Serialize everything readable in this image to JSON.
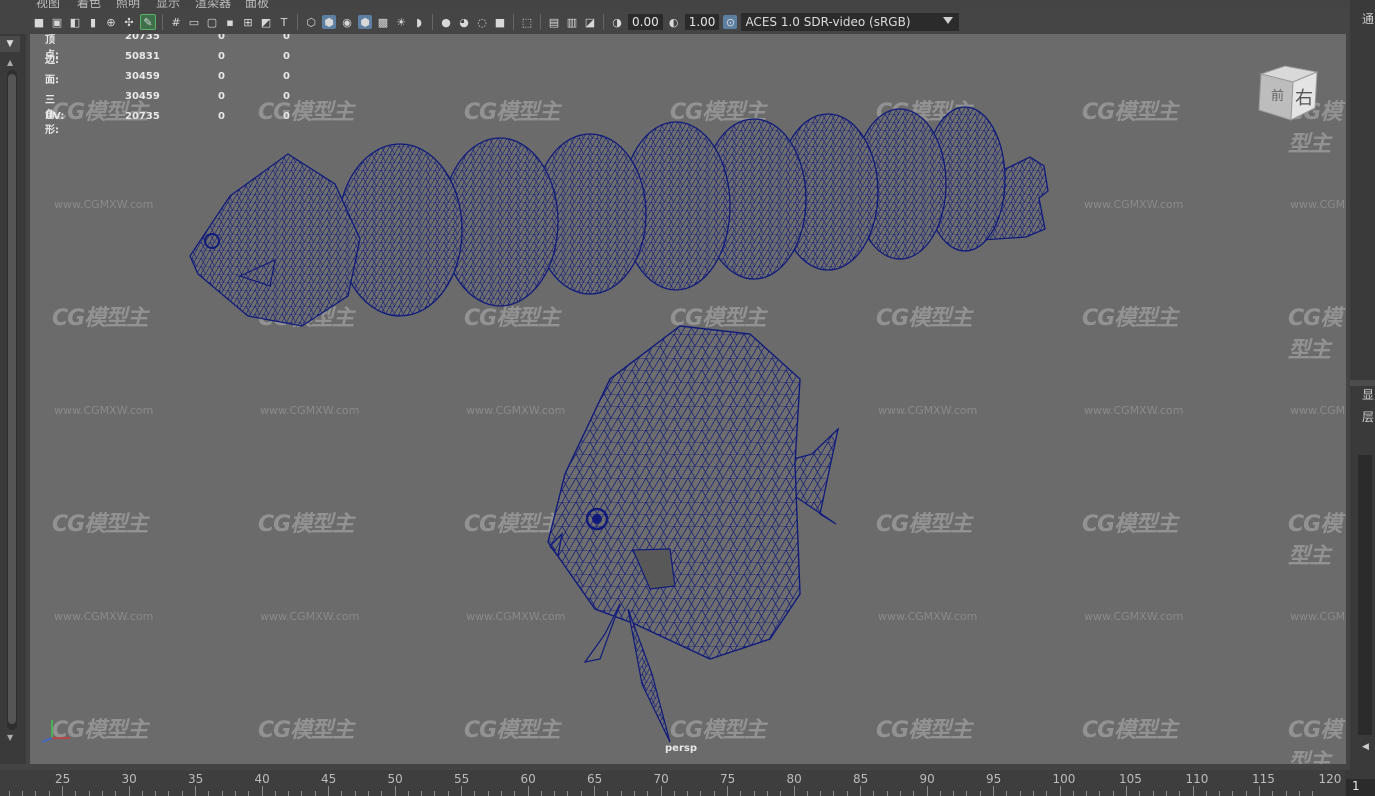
{
  "menubar": {
    "items": [
      "视图",
      "着色",
      "照明",
      "显示",
      "渲染器",
      "面板"
    ]
  },
  "toolbar": {
    "exposure": "0.00",
    "gamma": "1.00",
    "color_space": "ACES 1.0 SDR-video (sRGB)"
  },
  "hud": {
    "rows": [
      {
        "label": "顶点:",
        "v1": "20735",
        "v2": "0",
        "v3": "0"
      },
      {
        "label": "边:",
        "v1": "50831",
        "v2": "0",
        "v3": "0"
      },
      {
        "label": "面:",
        "v1": "30459",
        "v2": "0",
        "v3": "0"
      },
      {
        "label": "三角形:",
        "v1": "30459",
        "v2": "0",
        "v3": "0"
      },
      {
        "label": "UV:",
        "v1": "20735",
        "v2": "0",
        "v3": "0"
      }
    ]
  },
  "viewcube": {
    "front": "前",
    "right": "右"
  },
  "camera_label": "persp",
  "watermark": {
    "logo": "CG模型主",
    "url": "www.CGMXW.com"
  },
  "right_panel": {
    "top_label": "通",
    "label_a": "显",
    "label_b": "层"
  },
  "timeline": {
    "ticks": [
      "25",
      "30",
      "35",
      "40",
      "45",
      "50",
      "55",
      "60",
      "65",
      "70",
      "75",
      "80",
      "85",
      "90",
      "95",
      "100",
      "105",
      "110",
      "115",
      "120"
    ],
    "current_frame": "1"
  },
  "colors": {
    "viewport_bg": "#6b6b6b",
    "wire": "#101a7a",
    "active_icon": "#5d7fa1",
    "panel_bg": "#444444"
  },
  "icons": [
    "camera-icon",
    "grid-icon",
    "wireframe-icon",
    "shaded-icon",
    "lighting-icon",
    "isolate-icon",
    "xray-icon",
    "colorspace-icon"
  ]
}
